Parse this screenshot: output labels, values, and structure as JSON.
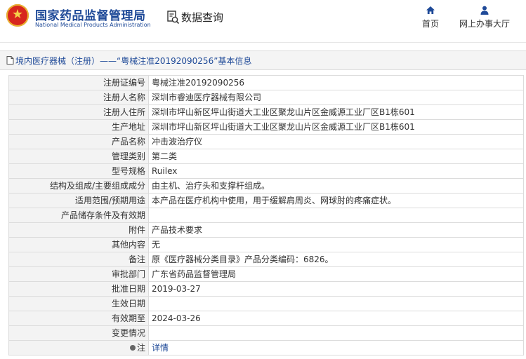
{
  "header": {
    "logo_cn": "国家药品监督管理局",
    "logo_en": "National Medical Products Administration",
    "query_label": "数据查询",
    "query_icon": "search-document-icon",
    "nav": [
      {
        "label": "首页",
        "icon": "home-icon"
      },
      {
        "label": "网上办事大厅",
        "icon": "user-icon"
      }
    ]
  },
  "title_bar": {
    "text": "境内医疗器械（注册）——“粤械注准20192090256”基本信息",
    "icon": "document-icon"
  },
  "rows": [
    {
      "label": "注册证编号",
      "value": "粤械注准20192090256"
    },
    {
      "label": "注册人名称",
      "value": "深圳市睿迪医疗器械有限公司"
    },
    {
      "label": "注册人住所",
      "value": "深圳市坪山新区坪山街道大工业区聚龙山片区金威源工业厂区B1栋601"
    },
    {
      "label": "生产地址",
      "value": "深圳市坪山新区坪山街道大工业区聚龙山片区金威源工业厂区B1栋601"
    },
    {
      "label": "产品名称",
      "value": "冲击波治疗仪"
    },
    {
      "label": "管理类别",
      "value": "第二类"
    },
    {
      "label": "型号规格",
      "value": "Ruilex"
    },
    {
      "label": "结构及组成/主要组成成分",
      "value": "由主机、治疗头和支撑杆组成。"
    },
    {
      "label": "适用范围/预期用途",
      "value": "本产品在医疗机构中使用，用于缓解肩周炎、网球肘的疼痛症状。"
    },
    {
      "label": "产品储存条件及有效期",
      "value": ""
    },
    {
      "label": "附件",
      "value": "产品技术要求"
    },
    {
      "label": "其他内容",
      "value": "无"
    },
    {
      "label": "备注",
      "value": "原《医疗器械分类目录》产品分类编码：6826。"
    },
    {
      "label": "审批部门",
      "value": "广东省药品监督管理局"
    },
    {
      "label": "批准日期",
      "value": "2019-03-27"
    },
    {
      "label": "生效日期",
      "value": ""
    },
    {
      "label": "有效期至",
      "value": "2024-03-26"
    },
    {
      "label": "变更情况",
      "value": ""
    }
  ],
  "note_row": {
    "label": "注",
    "value": "详情",
    "icon": "bullet-icon"
  },
  "colors": {
    "brand_blue": "#1f4a98",
    "emblem_red": "#d7261e",
    "label_bg": "#f3f3f3",
    "border": "#dcdcdc"
  }
}
